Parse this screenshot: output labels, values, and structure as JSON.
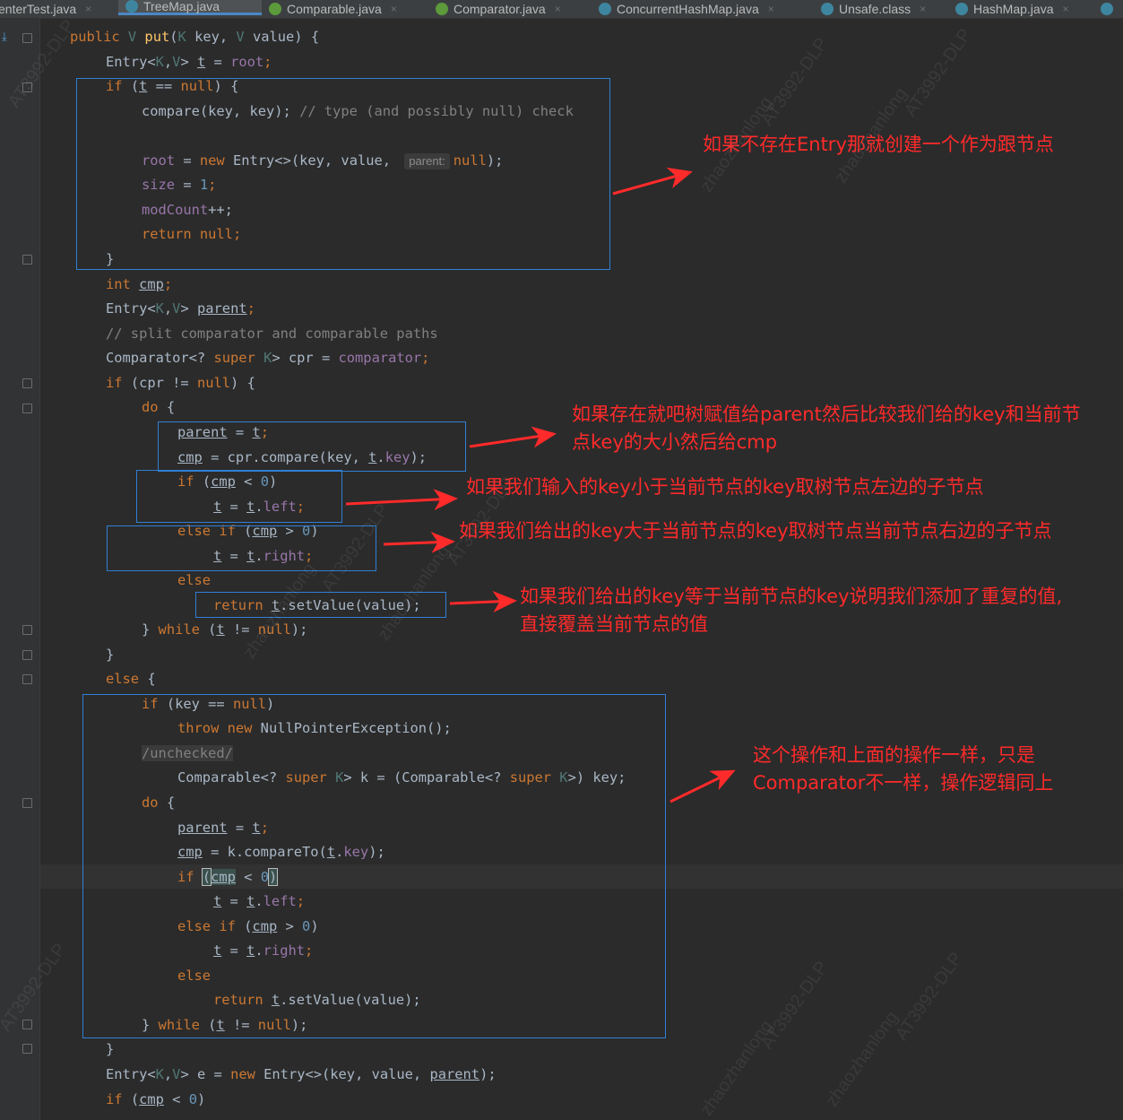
{
  "tabs": [
    {
      "label": "enterTest.java",
      "active": false
    },
    {
      "label": "TreeMap.java",
      "active": true
    },
    {
      "label": "Comparable.java",
      "active": false
    },
    {
      "label": "Comparator.java",
      "active": false
    },
    {
      "label": "ConcurrentHashMap.java",
      "active": false
    },
    {
      "label": "Unsafe.class",
      "active": false
    },
    {
      "label": "HashMap.java",
      "active": false
    }
  ],
  "tab_close_glyph": "×",
  "code": {
    "l01_a": "public ",
    "l01_b": "V ",
    "l01_c": "put",
    "l01_d": "(",
    "l01_e": "K ",
    "l01_f": "key, ",
    "l01_g": "V ",
    "l01_h": "value) {",
    "l02_a": "Entry<",
    "l02_b": "K",
    "l02_c": ",",
    "l02_d": "V",
    "l02_e": "> ",
    "l02_f": "t",
    "l02_g": " = ",
    "l02_h": "root",
    "l02_i": ";",
    "l03_a": "if ",
    "l03_b": "(",
    "l03_c": "t",
    "l03_d": " == ",
    "l03_e": "null",
    "l03_f": ") {",
    "l04_a": "compare(key, key); ",
    "l04_b": "// type (and possibly null) check",
    "l06_a": "root",
    "l06_b": " = ",
    "l06_c": "new ",
    "l06_d": "Entry<>(key, value, ",
    "l06_hint": "parent:",
    "l06_e": "null",
    "l06_f": ");",
    "l07_a": "size",
    "l07_b": " = ",
    "l07_c": "1",
    "l07_d": ";",
    "l08_a": "modCount",
    "l08_b": "++;",
    "l09_a": "return ",
    "l09_b": "null",
    "l09_c": ";",
    "l10_a": "}",
    "l11_a": "int ",
    "l11_b": "cmp",
    "l11_c": ";",
    "l12_a": "Entry<",
    "l12_b": "K",
    "l12_c": ",",
    "l12_d": "V",
    "l12_e": "> ",
    "l12_f": "parent",
    "l12_g": ";",
    "l13_a": "// split comparator and comparable paths",
    "l14_a": "Comparator<? ",
    "l14_b": "super ",
    "l14_c": "K",
    "l14_d": "> cpr = ",
    "l14_e": "comparator",
    "l14_f": ";",
    "l15_a": "if ",
    "l15_b": "(cpr != ",
    "l15_c": "null",
    "l15_d": ") {",
    "l16_a": "do ",
    "l16_b": "{",
    "l17_a": "parent",
    "l17_b": " = ",
    "l17_c": "t",
    "l17_d": ";",
    "l18_a": "cmp",
    "l18_b": " = cpr.compare(key, ",
    "l18_c": "t",
    "l18_d": ".",
    "l18_e": "key",
    "l18_f": ");",
    "l19_a": "if ",
    "l19_b": "(",
    "l19_c": "cmp",
    "l19_d": " < ",
    "l19_e": "0",
    "l19_f": ")",
    "l20_a": "t",
    "l20_b": " = ",
    "l20_c": "t",
    "l20_d": ".",
    "l20_e": "left",
    "l20_f": ";",
    "l21_a": "else if ",
    "l21_b": "(",
    "l21_c": "cmp",
    "l21_d": " > ",
    "l21_e": "0",
    "l21_f": ")",
    "l22_a": "t",
    "l22_b": " = ",
    "l22_c": "t",
    "l22_d": ".",
    "l22_e": "right",
    "l22_f": ";",
    "l23_a": "else",
    "l24_a": "return ",
    "l24_b": "t",
    "l24_c": ".setValue(value);",
    "l25_a": "} ",
    "l25_b": "while ",
    "l25_c": "(",
    "l25_d": "t",
    "l25_e": " != ",
    "l25_f": "null",
    "l25_g": ");",
    "l26_a": "}",
    "l27_a": "else ",
    "l27_b": "{",
    "l28_a": "if ",
    "l28_b": "(key == ",
    "l28_c": "null",
    "l28_d": ")",
    "l29_a": "throw new ",
    "l29_b": "NullPointerException();",
    "l30_a": "/unchecked/",
    "l31_a": "Comparable<? ",
    "l31_b": "super ",
    "l31_c": "K",
    "l31_d": "> k = (Comparable<? ",
    "l31_e": "super ",
    "l31_f": "K",
    "l31_g": ">) key;",
    "l32_a": "do ",
    "l32_b": "{",
    "l33_a": "parent",
    "l33_b": " = ",
    "l33_c": "t",
    "l33_d": ";",
    "l34_a": "cmp",
    "l34_b": " = k.compareTo(",
    "l34_c": "t",
    "l34_d": ".",
    "l34_e": "key",
    "l34_f": ");",
    "l35_a": "if ",
    "l35_b": "(",
    "l35_c": "cmp",
    "l35_d": " < ",
    "l35_e": "0",
    "l35_f": ")",
    "l36_a": "t",
    "l36_b": " = ",
    "l36_c": "t",
    "l36_d": ".",
    "l36_e": "left",
    "l36_f": ";",
    "l37_a": "else if ",
    "l37_b": "(",
    "l37_c": "cmp",
    "l37_d": " > ",
    "l37_e": "0",
    "l37_f": ")",
    "l38_a": "t",
    "l38_b": " = ",
    "l38_c": "t",
    "l38_d": ".",
    "l38_e": "right",
    "l38_f": ";",
    "l39_a": "else",
    "l40_a": "return ",
    "l40_b": "t",
    "l40_c": ".setValue(value);",
    "l41_a": "} ",
    "l41_b": "while ",
    "l41_c": "(",
    "l41_d": "t",
    "l41_e": " != ",
    "l41_f": "null",
    "l41_g": ");",
    "l42_a": "}",
    "l43_a": "Entry<",
    "l43_b": "K",
    "l43_c": ",",
    "l43_d": "V",
    "l43_e": "> e = ",
    "l43_f": "new ",
    "l43_g": "Entry<>(key, value, ",
    "l43_h": "parent",
    "l43_i": ");",
    "l44_a": "if ",
    "l44_b": "(",
    "l44_c": "cmp",
    "l44_d": " < ",
    "l44_e": "0",
    "l44_f": ")"
  },
  "annotations": {
    "note1": "如果不存在Entry那就创建一个作为跟节点",
    "note2_line1": "如果存在就吧树赋值给parent然后比较我们给的key和当前节",
    "note2_line2": "点key的大小然后给cmp",
    "note3": "如果我们输入的key小于当前节点的key取树节点左边的子节点",
    "note4": "如果我们给出的key大于当前节点的key取树节点当前节点右边的子节点",
    "note5_line1": "如果我们给出的key等于当前节点的key说明我们添加了重复的值,",
    "note5_line2": "直接覆盖当前节点的值",
    "note6_line1": "这个操作和上面的操作一样，只是",
    "note6_line2": "Comparator不一样，操作逻辑同上"
  },
  "watermark": {
    "code": "AT3992-DLP",
    "name": "zhaozhanlong"
  },
  "colors": {
    "editor_bg": "#2b2b2b",
    "keyword": "#cc7832",
    "field": "#9876aa",
    "number": "#6897bb",
    "method": "#ffc66d",
    "type_param": "#507874",
    "comment": "#808080",
    "annotation_red": "#ff2a2a",
    "box_blue": "#2f7fd6"
  }
}
